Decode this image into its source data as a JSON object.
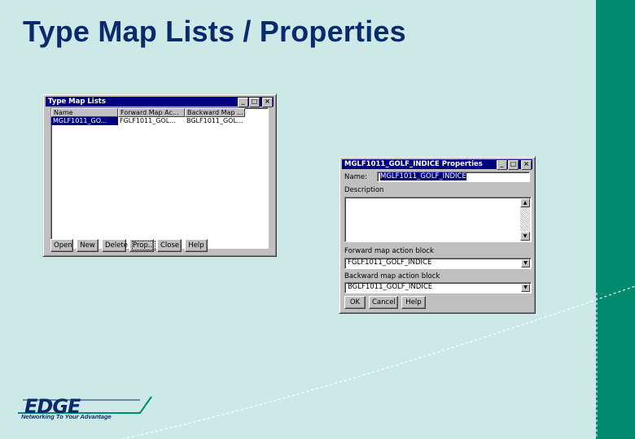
{
  "slide": {
    "title": "Type Map Lists / Properties"
  },
  "list_window": {
    "title": "Type Map Lists",
    "columns": [
      "Name",
      "Forward Map Ac...",
      "Backward Map ..."
    ],
    "rows": [
      [
        "MGLF1011_GO...",
        "FGLF1011_GOL...",
        "BGLF1011_GOL..."
      ]
    ],
    "buttons": [
      "Open",
      "New",
      "Delete",
      "Prop...",
      "Close",
      "Help"
    ]
  },
  "prop_window": {
    "title": "MGLF1011_GOLF_INDICE Properties",
    "name_label": "Name:",
    "name_value": "MGLF1011_GOLF_INDICE",
    "description_label": "Description",
    "forward_label": "Forward map action block",
    "forward_value": "FGLF1011_GOLF_INDICE",
    "backward_label": "Backward map action block",
    "backward_value": "BGLF1011_GOLF_INDICE",
    "buttons": [
      "OK",
      "Cancel",
      "Help"
    ]
  },
  "window_controls": {
    "minimize": "_",
    "maximize": "□",
    "close": "×"
  },
  "logo": {
    "word": "EDGE",
    "tagline": "Networking To Your Advantage"
  },
  "colors": {
    "background": "#cde9e7",
    "accent": "#008a6e",
    "title": "#0b2a6b",
    "titlebar": "#000080"
  }
}
